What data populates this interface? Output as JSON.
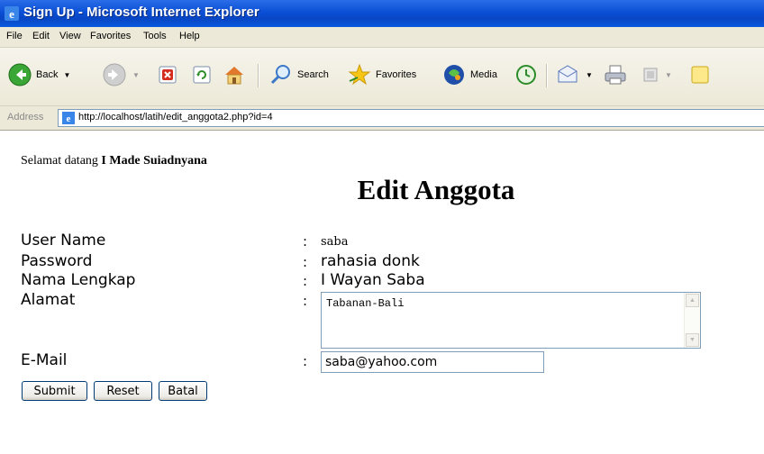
{
  "window": {
    "title": "Sign Up - Microsoft Internet Explorer"
  },
  "menu": [
    "File",
    "Edit",
    "View",
    "Favorites",
    "Tools",
    "Help"
  ],
  "toolbar": {
    "back": "Back",
    "search": "Search",
    "favorites": "Favorites",
    "media": "Media"
  },
  "address": {
    "label": "Address",
    "url": "http://localhost/latih/edit_anggota2.php?id=4"
  },
  "page": {
    "welcome_prefix": "Selamat datang",
    "welcome_name": "I Made Suiadnyana",
    "heading": "Edit Anggota",
    "colon": ":",
    "fields": {
      "username_label": "User Name",
      "username_value": "saba",
      "password_label": "Password",
      "password_value": "rahasia donk",
      "fullname_label": "Nama Lengkap",
      "fullname_value": "I Wayan Saba",
      "address_label": "Alamat",
      "address_value": "Tabanan-Bali",
      "email_label": "E-Mail",
      "email_value": "saba@yahoo.com"
    },
    "buttons": {
      "submit": "Submit",
      "reset": "Reset",
      "cancel": "Batal"
    }
  }
}
